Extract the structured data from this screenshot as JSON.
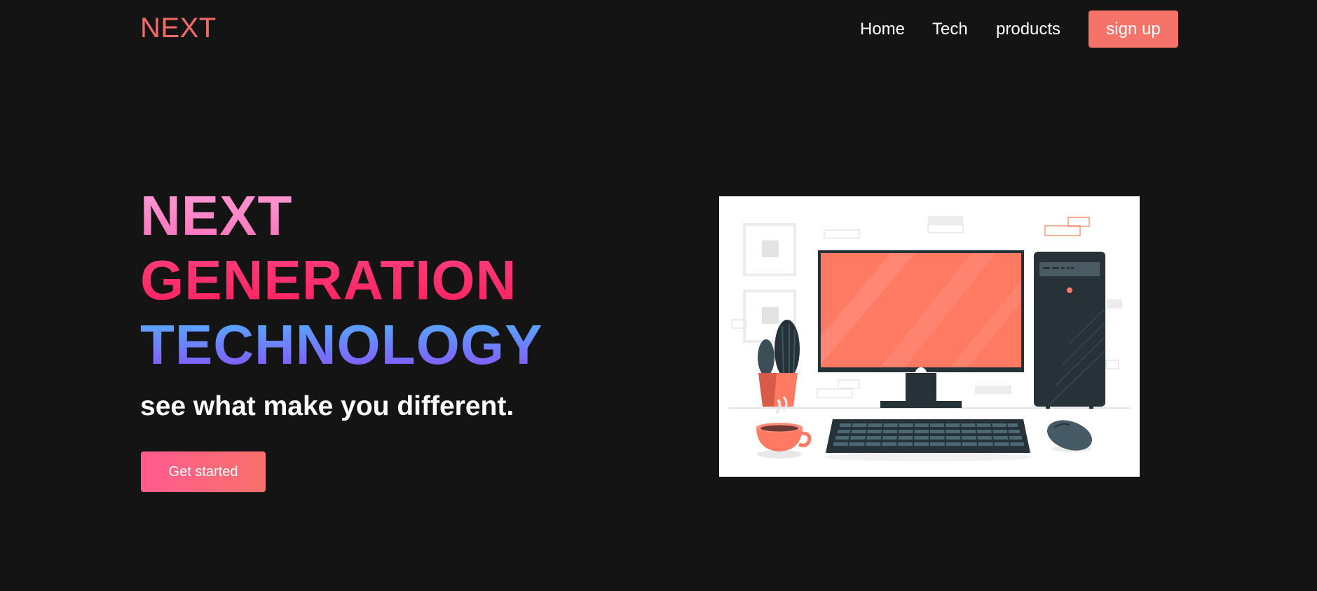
{
  "header": {
    "logo": "NEXT",
    "nav": [
      {
        "label": "Home"
      },
      {
        "label": "Tech"
      },
      {
        "label": "products"
      }
    ],
    "signup_label": "sign up"
  },
  "hero": {
    "line1": "NEXT",
    "line2": "GENERATION",
    "line3": "TECHNOLOGY",
    "subtitle": "see what make you different.",
    "cta_label": "Get started"
  },
  "colors": {
    "background": "#141414",
    "logo": "#f26b6b",
    "signup_button": "#f57368",
    "line1_gradient": [
      "#ff9ed8",
      "#ff6fb8"
    ],
    "line2_gradient": [
      "#ff3f7d",
      "#ff1f5f"
    ],
    "line3_gradient": [
      "#4fb6ff",
      "#8a4dff"
    ],
    "cta_gradient": [
      "#ff5b8f",
      "#f8716a"
    ]
  },
  "illustration": {
    "icon": "desktop-computer-illustration"
  }
}
